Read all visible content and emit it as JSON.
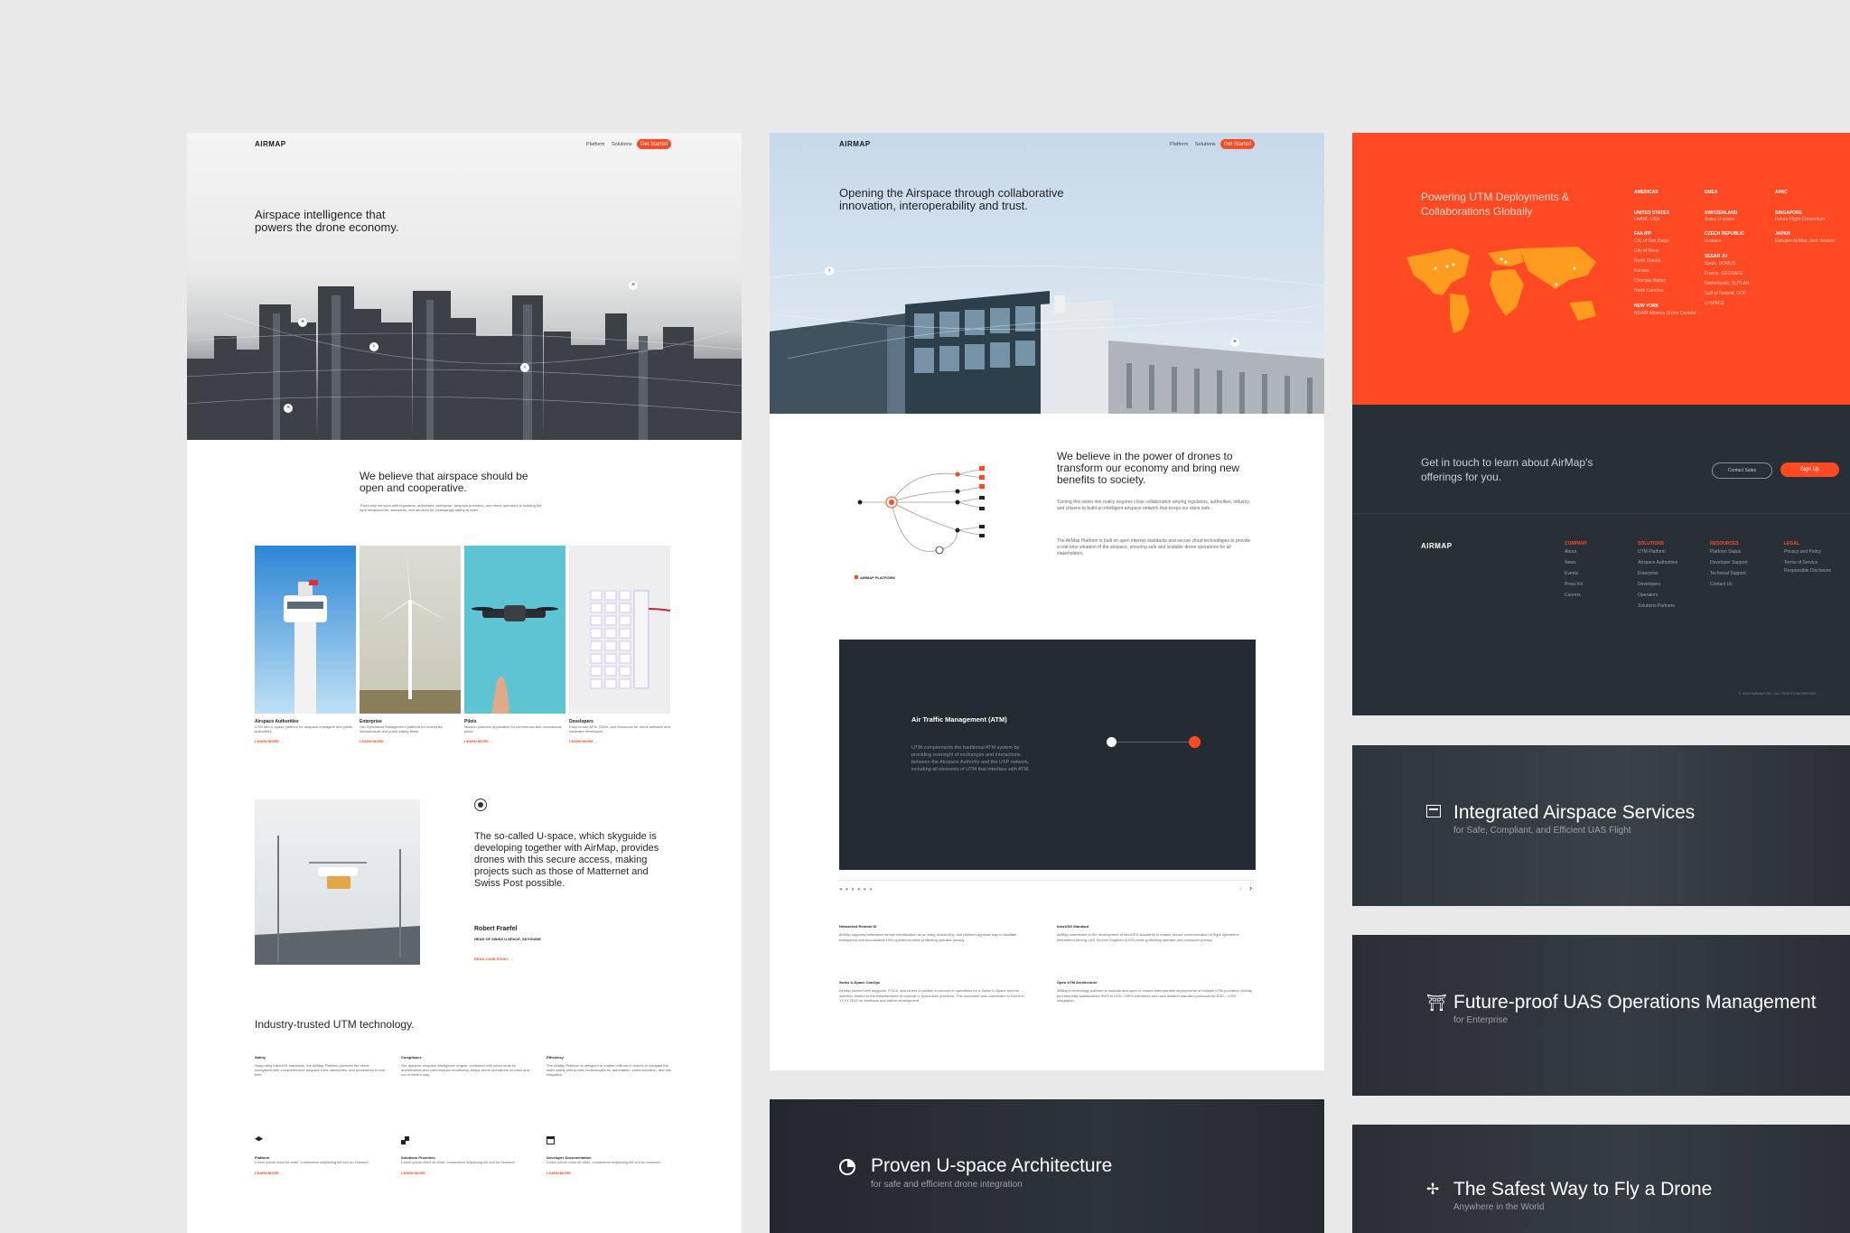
{
  "panel_left": {
    "logo": "AIRMAP",
    "nav": [
      "Platform",
      "Solutions"
    ],
    "cta": "Get Started",
    "hero_title": "Airspace intelligence that powers the drone economy.",
    "belief_title": "We believe that airspace should be open and cooperative.",
    "belief_body": "That's why we work with regulators, authorities, enterprise, airspace providers, and drone operators in building the right infrastructure, standards, and services for increasingly safety at scale.",
    "cards": [
      {
        "title": "Airspace Authorities",
        "body": "UTM and U-space platform for airspace managers and public authorities.",
        "link": "LEARN MORE →"
      },
      {
        "title": "Enterprise",
        "body": "Get Operations Management platform for enterprise infrastructure and public safety fleets.",
        "link": "LEARN MORE →"
      },
      {
        "title": "Pilots",
        "body": "Mission planners application for commercial and recreational pilots.",
        "link": "LEARN MORE →"
      },
      {
        "title": "Developers",
        "body": "Easy-to-use APIs, SDKs, and resources for drone software and hardware developers.",
        "link": "LEARN MORE →"
      }
    ],
    "quote": "The so-called U-space, which skyguide is developing together with AirMap, provides drones with this secure access, making projects such as those of Matternet and Swiss Post possible.",
    "quote_author": "Robert Fraefel",
    "quote_role": "HEAD OF SWISS U-SPACE, SKYGUIDE",
    "quote_link": "READ CASE STUDY →",
    "industry_title": "Industry-trusted UTM technology.",
    "features": [
      {
        "title": "Safety",
        "body": "Supporting interUSS standards, the AirMap Platform provides the drone ecosystem with comprehensive airspace rules, advisories, and procedures in real time."
      },
      {
        "title": "Compliance",
        "body": "Our dynamic airspace intelligence engine, combined with smart tools for authorization and conformance monitoring, keeps drone operations on track and out of harm's way."
      },
      {
        "title": "Efficiency",
        "body": "The AirMap Platform is designed to enable millions of drones to navigate the skies safely with proven technologies for automation, communication, and risk mitigation."
      }
    ],
    "bottom_links": [
      {
        "title": "Platform",
        "body": "Lorem ipsum dolor sit amet, consectetur adipiscing elit sed do eiusmod.",
        "link": "LEARN MORE →"
      },
      {
        "title": "Solutions Providers",
        "body": "Lorem ipsum dolor sit amet, consectetur adipiscing elit sed do eiusmod.",
        "link": "LEARN MORE →"
      },
      {
        "title": "Developer Documentation",
        "body": "Lorem ipsum dolor sit amet, consectetur adipiscing elit sed do eiusmod.",
        "link": "LEARN MORE →"
      }
    ]
  },
  "panel_middle": {
    "logo": "AIRMAP",
    "nav": [
      "Platform",
      "Solutions"
    ],
    "cta": "Get Started",
    "hero_title": "Opening the Airspace through collaborative innovation, interoperability and trust.",
    "belief_title": "We believe in the power of drones to transform our economy and bring new benefits to society.",
    "belief_body1": "Turning this vision into reality requires close collaboration among regulators, authorities, industry, and citizens to build an intelligent airspace network that keeps our skies safe.",
    "belief_body2": "The AirMap Platform is built on open internet standards and secure cloud technologies to provide a real-time situation of the airspace, ensuring safe and scalable drone operations for all stakeholders.",
    "diagram_label": "AIRMAP PLATFORM",
    "atm_title": "Air Traffic Management (ATM)",
    "atm_body": "UTM complements the traditional ATM system by providing oversight of exchanges and interactions between the Airspace Authority and the USP network, including all elements of UTM that interface with ATM.",
    "standards": [
      {
        "title": "Networked Remote ID",
        "body": "AirMap supports networked remote identification as an easy, trustworthy, and platform-agnostic way to facilitate transparent and accountable UAS operations while protecting operator privacy."
      },
      {
        "title": "InterUSS Standard",
        "body": "AirMap contributes to the development of InterUSS standards to enable secure communication of flight operations information among UAS Service Suppliers (USS) while protecting operator and consumer privacy."
      },
      {
        "title": "Swiss U-Space ConOps",
        "body": "AirMap worked with skyguide, FOCA, and others to publish a concept of operations for a Swiss U-Space and the activities related to the establishment of national U-Space-ban practices. This document was contributed to EASA in YYYY 2019 for feedback and further development."
      },
      {
        "title": "Open UTM Architecture",
        "body": "AirMap's technology platform is modular and open to ensure interoperable deployments of multiple UTM providers. AirMap provides fully standardized RWS to USS / USPs interfaces and uses aviation standard protocols for ATM – UTM integration."
      }
    ],
    "banner_title": "Proven U-space Architecture",
    "banner_sub": "for safe and efficient drone integration"
  },
  "panel_right": {
    "deploy_title": "Powering UTM Deployments & Collaborations Globally",
    "regions": [
      {
        "region": "AMERICAS",
        "groups": [
          {
            "country": "UNITED STATES",
            "items": [
              "LAANC USS"
            ]
          },
          {
            "country": "FAA IPP",
            "items": [
              "City of San Diego",
              "City of Reno",
              "North Dakota",
              "Kansas",
              "Choctaw Nation",
              "North Carolina"
            ]
          },
          {
            "country": "NEW YORK",
            "items": [
              "NUAIR Alliance Drone Corridor"
            ]
          }
        ]
      },
      {
        "region": "EMEA",
        "groups": [
          {
            "country": "SWITZERLAND",
            "items": [
              "Swiss U-space"
            ]
          },
          {
            "country": "CZECH REPUBLIC",
            "items": [
              "U-space"
            ]
          },
          {
            "country": "SESAR JU",
            "items": [
              "Spain, DOMUS",
              "France, GEOSAFE",
              "Netherlands, SUTLAN",
              "Gulf of Finland, GOF",
              "U-SPACE"
            ]
          }
        ]
      },
      {
        "region": "APAC",
        "groups": [
          {
            "country": "SINGAPORE",
            "items": [
              "Future Flight Consortium"
            ]
          },
          {
            "country": "JAPAN",
            "items": [
              "Rakuten AirMap Joint Venture"
            ]
          }
        ]
      }
    ],
    "contact_title": "Get in touch to learn about AirMap's offerings for you.",
    "contact_btn": "Contact Sales",
    "signup_btn": "Sign Up",
    "footer_logo": "AIRMAP",
    "footer_cols": [
      {
        "title": "COMPANY",
        "items": [
          "About",
          "News",
          "Events",
          "Press Kit",
          "Careers"
        ]
      },
      {
        "title": "SOLUTIONS",
        "items": [
          "UTM Platform",
          "Airspace Authorities",
          "Enterprise",
          "Developers",
          "Operators",
          "Solutions Partners"
        ]
      },
      {
        "title": "RESOURCES",
        "items": [
          "Platform Status",
          "Developer Support",
          "Technical Support",
          "Contact Us"
        ]
      },
      {
        "title": "LEGAL",
        "items": [
          "Privacy and Policy",
          "Terms of Service",
          "Responsible Disclosure"
        ]
      }
    ],
    "copyright": "© 2019 AIRMAP INC. ALL RIGHTS RESERVED",
    "banners": [
      {
        "title": "Integrated Airspace Services",
        "sub": "for Safe, Compliant, and Efficient UAS Flight",
        "icon": "server-icon"
      },
      {
        "title": "Future-proof UAS Operations Management",
        "sub": "for Enterprise",
        "icon": "tower-icon"
      },
      {
        "title": "The Safest Way to Fly a Drone",
        "sub": "Anywhere in the World",
        "icon": "drone-icon"
      }
    ]
  }
}
